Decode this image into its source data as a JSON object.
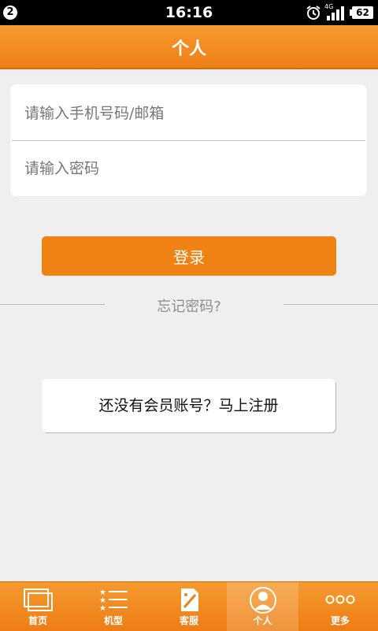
{
  "status_bar": {
    "notification_count": "2",
    "time": "16:16",
    "network": "4G",
    "battery": "62",
    "icons": [
      "alarm-icon",
      "signal-icon",
      "battery-icon"
    ]
  },
  "header": {
    "title": "个人"
  },
  "login_form": {
    "phone_placeholder": "请输入手机号码/邮箱",
    "phone_value": "",
    "password_placeholder": "请输入密码",
    "password_value": "",
    "login_label": "登录",
    "forgot_label": "忘记密码?"
  },
  "register": {
    "label": "还没有会员账号？马上注册"
  },
  "tabbar": {
    "items": [
      {
        "label": "首页",
        "icon": "home-icon"
      },
      {
        "label": "机型",
        "icon": "list-icon"
      },
      {
        "label": "客服",
        "icon": "service-icon"
      },
      {
        "label": "个人",
        "icon": "person-icon",
        "active": true
      },
      {
        "label": "更多",
        "icon": "more-icon"
      }
    ]
  },
  "colors": {
    "accent": "#ef8212",
    "background": "#efefef",
    "status_bar": "#000000"
  }
}
